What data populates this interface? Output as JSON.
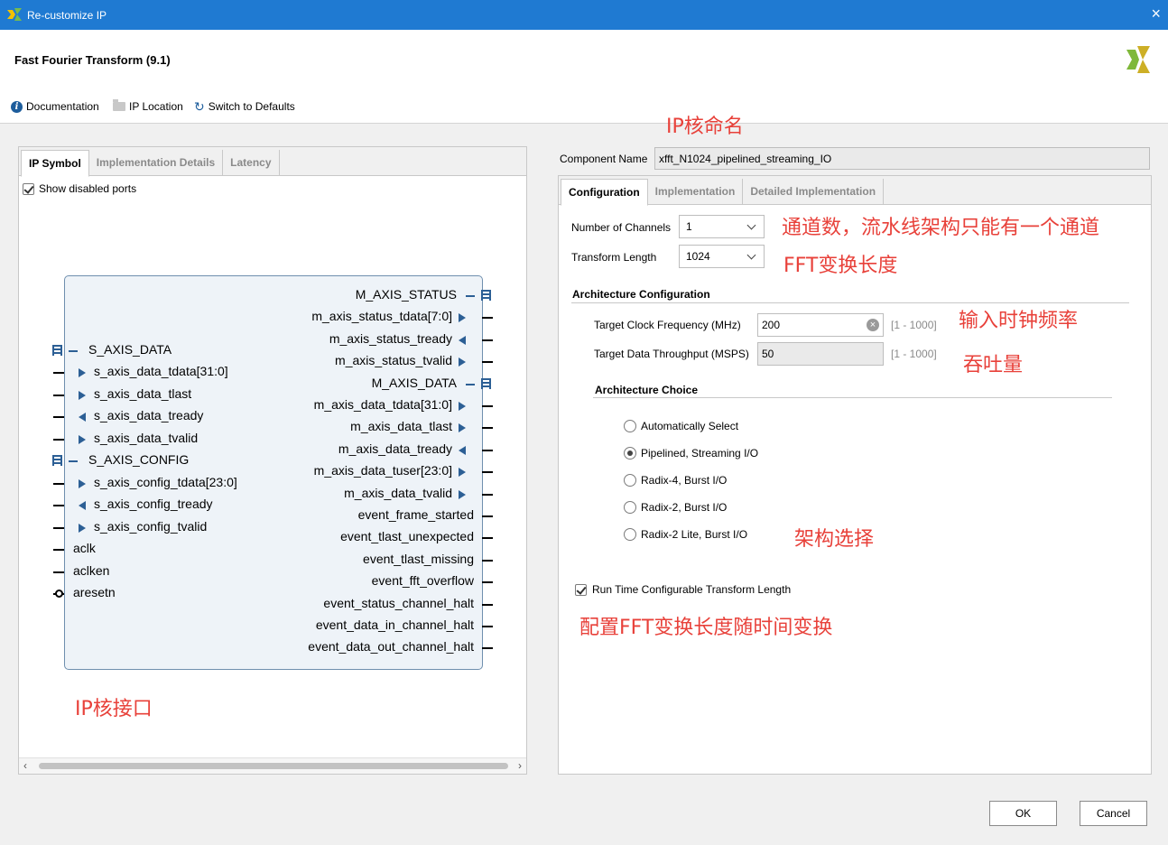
{
  "window": {
    "title": "Re-customize IP",
    "close_icon": "×"
  },
  "header": {
    "ip_name": "Fast Fourier Transform (9.1)"
  },
  "toolbar": {
    "documentation": "Documentation",
    "ip_location": "IP Location",
    "switch_defaults": "Switch to Defaults"
  },
  "left": {
    "tabs": [
      "IP Symbol",
      "Implementation Details",
      "Latency"
    ],
    "show_disabled_ports": "Show disabled ports",
    "ports_left": [
      {
        "name": "S_AXIS_DATA",
        "kind": "bus"
      },
      {
        "name": "s_axis_data_tdata[31:0]",
        "kind": "in"
      },
      {
        "name": "s_axis_data_tlast",
        "kind": "in"
      },
      {
        "name": "s_axis_data_tready",
        "kind": "out"
      },
      {
        "name": "s_axis_data_tvalid",
        "kind": "in"
      },
      {
        "name": "S_AXIS_CONFIG",
        "kind": "bus"
      },
      {
        "name": "s_axis_config_tdata[23:0]",
        "kind": "in"
      },
      {
        "name": "s_axis_config_tready",
        "kind": "out"
      },
      {
        "name": "s_axis_config_tvalid",
        "kind": "in"
      },
      {
        "name": "aclk",
        "kind": "pin"
      },
      {
        "name": "aclken",
        "kind": "pin"
      },
      {
        "name": "aresetn",
        "kind": "pin-n"
      }
    ],
    "ports_right": [
      {
        "name": "M_AXIS_STATUS",
        "kind": "bus"
      },
      {
        "name": "m_axis_status_tdata[7:0]",
        "kind": "out"
      },
      {
        "name": "m_axis_status_tready",
        "kind": "in"
      },
      {
        "name": "m_axis_status_tvalid",
        "kind": "out"
      },
      {
        "name": "M_AXIS_DATA",
        "kind": "bus"
      },
      {
        "name": "m_axis_data_tdata[31:0]",
        "kind": "out"
      },
      {
        "name": "m_axis_data_tlast",
        "kind": "out"
      },
      {
        "name": "m_axis_data_tready",
        "kind": "in"
      },
      {
        "name": "m_axis_data_tuser[23:0]",
        "kind": "out"
      },
      {
        "name": "m_axis_data_tvalid",
        "kind": "out"
      },
      {
        "name": "event_frame_started",
        "kind": "pin"
      },
      {
        "name": "event_tlast_unexpected",
        "kind": "pin"
      },
      {
        "name": "event_tlast_missing",
        "kind": "pin"
      },
      {
        "name": "event_fft_overflow",
        "kind": "pin"
      },
      {
        "name": "event_status_channel_halt",
        "kind": "pin"
      },
      {
        "name": "event_data_in_channel_halt",
        "kind": "pin"
      },
      {
        "name": "event_data_out_channel_halt",
        "kind": "pin"
      }
    ]
  },
  "right": {
    "component_name_label": "Component Name",
    "component_name_value": "xfft_N1024_pipelined_streaming_IO",
    "tabs": [
      "Configuration",
      "Implementation",
      "Detailed Implementation"
    ],
    "channels_label": "Number of Channels",
    "channels_value": "1",
    "transform_length_label": "Transform Length",
    "transform_length_value": "1024",
    "arch_config_title": "Architecture Configuration",
    "clock_label": "Target Clock Frequency (MHz)",
    "clock_value": "200",
    "clock_range": "[1 - 1000]",
    "throughput_label": "Target Data Throughput (MSPS)",
    "throughput_value": "50",
    "throughput_range": "[1 - 1000]",
    "arch_choice_title": "Architecture Choice",
    "arch_options": [
      "Automatically Select",
      "Pipelined, Streaming I/O",
      "Radix-4, Burst I/O",
      "Radix-2, Burst I/O",
      "Radix-2 Lite, Burst I/O"
    ],
    "arch_selected": 1,
    "runtime_label": "Run Time Configurable Transform Length"
  },
  "annotations": {
    "ip_name": "IP核命名",
    "channels": "通道数，流水线架构只能有一个通道",
    "fft_length": "FFT变换长度",
    "clock": "输入时钟频率",
    "throughput": "吞吐量",
    "arch": "架构选择",
    "runtime": "配置FFT变换长度随时间变换",
    "ports": "IP核接口"
  },
  "footer": {
    "ok": "OK",
    "cancel": "Cancel"
  },
  "colors": {
    "titlebar": "#1f7ad2",
    "annotation": "#e8413a",
    "symbol_fill": "#eef3f8",
    "symbol_border": "#6f8fae",
    "port_arrow": "#2c5f95"
  }
}
